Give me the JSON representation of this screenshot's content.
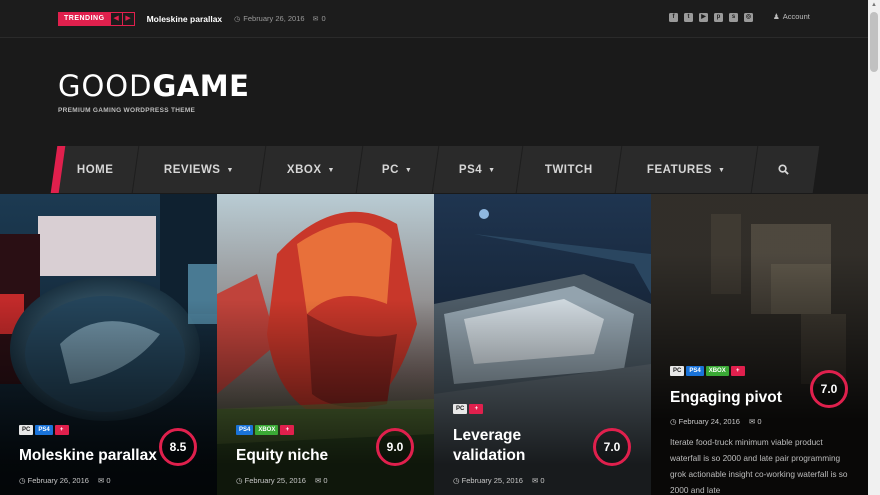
{
  "topbar": {
    "trending_label": "TRENDING",
    "prev_icon": "chevron-left-icon",
    "next_icon": "chevron-right-icon",
    "trending_title": "Moleskine parallax",
    "date": "February 26, 2016",
    "comments": "0",
    "social_icons": [
      "facebook-icon",
      "twitter-icon",
      "youtube-icon",
      "pinterest-icon",
      "steam-icon",
      "instagram-icon"
    ],
    "account_label": "Account"
  },
  "header": {
    "logo_left": "GOOD",
    "logo_right": "GAME",
    "tagline": "PREMIUM GAMING WORDPRESS THEME"
  },
  "nav": {
    "items": [
      {
        "label": "HOME",
        "caret": false
      },
      {
        "label": "REVIEWS",
        "caret": true
      },
      {
        "label": "XBOX",
        "caret": true
      },
      {
        "label": "PC",
        "caret": true
      },
      {
        "label": "PS4",
        "caret": true
      },
      {
        "label": "TWITCH",
        "caret": false
      },
      {
        "label": "FEATURES",
        "caret": true
      }
    ],
    "search_icon": "search-icon"
  },
  "cards": [
    {
      "title": "Moleskine parallax",
      "tags": [
        "PC",
        "PS4",
        "+"
      ],
      "score": "8.5",
      "date": "February 26, 2016",
      "comments": "0"
    },
    {
      "title": "Equity niche",
      "tags": [
        "PS4",
        "XBOX",
        "+"
      ],
      "score": "9.0",
      "date": "February 25, 2016",
      "comments": "0"
    },
    {
      "title_line1": "Leverage",
      "title_line2": "validation",
      "tags": [
        "PC",
        "+"
      ],
      "score": "7.0",
      "date": "February 25, 2016",
      "comments": "0"
    },
    {
      "title": "Engaging pivot",
      "tags": [
        "PC",
        "PS4",
        "XBOX",
        "+"
      ],
      "score": "7.0",
      "date": "February 24, 2016",
      "comments": "0",
      "excerpt": "Iterate food-truck minimum viable product waterfall is so 2000 and late pair programming grok actionable insight co-working waterfall is so 2000 and late"
    }
  ],
  "colors": {
    "accent": "#e0204d",
    "ps4": "#1a73d9",
    "xbox": "#3aa935"
  }
}
